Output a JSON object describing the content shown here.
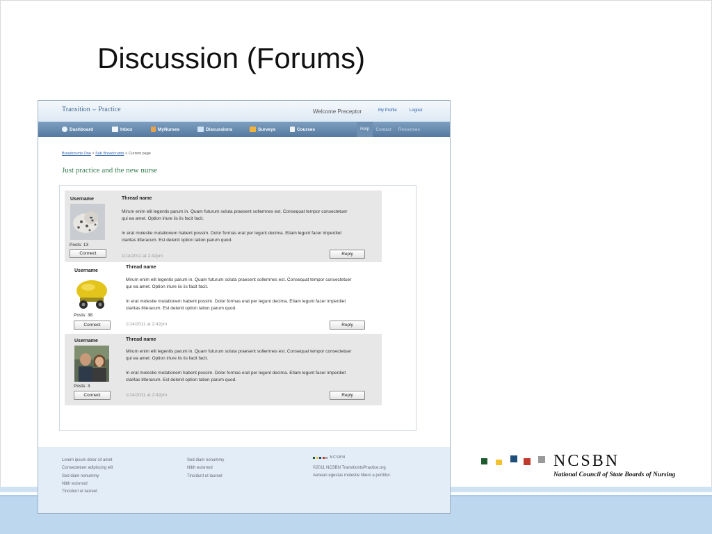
{
  "slide": {
    "title": "Discussion (Forums)"
  },
  "app": {
    "logo_text": "Transition",
    "logo_text2": "Practice",
    "welcome": "Welcome Preceptor",
    "my_profile": "My Profile",
    "logout": "Logout",
    "nav": [
      {
        "label": "Dashboard",
        "icon": "dashboard-icon"
      },
      {
        "label": "Inbox",
        "icon": "inbox-icon"
      },
      {
        "label": "MyNurses",
        "icon": "nurses-icon"
      },
      {
        "label": "Discussions",
        "icon": "discussions-icon"
      },
      {
        "label": "Surveys",
        "icon": "surveys-icon"
      },
      {
        "label": "Courses",
        "icon": "courses-icon"
      }
    ],
    "nav_right": [
      "Help",
      "Contact",
      "Resources"
    ],
    "breadcrumb": {
      "one": "Breadcrumb One",
      "sep1": " > ",
      "two": "Sub Breadcrumb",
      "sep2": " > ",
      "current": "Current page"
    },
    "page_heading": "Just practice and the new nurse"
  },
  "posts": [
    {
      "username": "Username",
      "posts_label": "Posts: 13",
      "connect": "Connect",
      "thread": "Thread name",
      "para1": "Mirum enim elit legentis parum in. Quam futurum soluta praesent sollemnes est. Consequat tempor consectetuer qui ea amet. Option iriure iis iis facit facit.",
      "para2": "In erat molestie mutationem habent possim. Dolor formas erat per legunt decima. Etiam legunt facer imperdiet claritas litterarum. Est delenit option tation parum quod.",
      "date": "1/14/2011 at 2:42pm",
      "reply": "Reply"
    },
    {
      "username": "Username",
      "posts_label": "Posts:   38",
      "connect": "Connect",
      "thread": "Thread name",
      "para1": "Mirum enim elit legentis parum in. Quam futurum soluta praesent sollemnes est. Consequat tempor consectetuer qui ea amet. Option iriure iis iis facit facit.",
      "para2": "In erat molestie mutationem habent possim. Dolor formas erat per legunt decima. Etiam legunt facer imperdiet claritas litterarum. Est delenit option tation parum quod.",
      "date": "1/14/2011 at 2:42pm",
      "reply": "Reply"
    },
    {
      "username": "Username",
      "posts_label": "Posts:   3",
      "connect": "Connect",
      "thread": "Thread name",
      "para1": "Mirum enim elit legentis parum in. Quam futurum soluta praesent sollemnes est. Consequat tempor consectetuer qui ea amet. Option iriure iis iis facit facit.",
      "para2": "In erat molestie mutationem habent possim. Dolor formas erat per legunt decima. Etiam legunt facer imperdiet claritas litterarum. Est delenit option tation parum quod.",
      "date": "1/14/2011 at 2:42pm",
      "reply": "Reply"
    }
  ],
  "footer": {
    "col1": [
      "Lorem ipsum dolor sit amet",
      "Consectetuer adipiscing elit",
      "Sed diam nonummy",
      "Nibh euismod",
      "Tincidunt ut laoreet"
    ],
    "col2": [
      "Sed diam nonummy",
      "Nibh euismod",
      "Tincidunt ut laoreet"
    ],
    "mini_logo": "NCSBN",
    "copyright": "©2011 NCSBN TransitiontoPractice.org",
    "tagline": "Aenean egestas molestie libero a porttitor."
  },
  "ncsbn": {
    "name": "NCSBN",
    "full": "National Council of State Boards of Nursing",
    "colors": [
      "#1f5a2e",
      "#f2c12e",
      "#1e4f7a",
      "#c0392b",
      "#9a9a9a"
    ]
  }
}
